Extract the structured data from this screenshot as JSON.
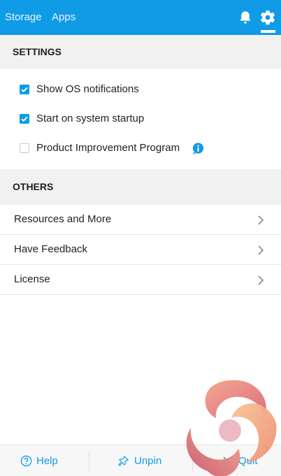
{
  "header": {
    "tabs": [
      {
        "label": "Storage",
        "icon": "storage"
      },
      {
        "label": "Apps",
        "icon": "apps"
      }
    ],
    "icons": [
      "bell-icon",
      "gear-icon"
    ],
    "active_icon": "gear-icon"
  },
  "settings": {
    "title": "SETTINGS",
    "options": [
      {
        "label": "Show OS notifications",
        "checked": true
      },
      {
        "label": "Start on system startup",
        "checked": true
      },
      {
        "label": "Product Improvement Program",
        "checked": false,
        "info_icon": "info-icon"
      }
    ]
  },
  "others": {
    "title": "OTHERS",
    "items": [
      {
        "label": "Resources and More"
      },
      {
        "label": "Have Feedback"
      },
      {
        "label": "License"
      }
    ]
  },
  "footer": {
    "help_label": "Help",
    "unpin_label": "Unpin",
    "quit_label": "Quit"
  },
  "colors": {
    "accent": "#0f9be6",
    "section_bg": "#f1f1f1"
  }
}
